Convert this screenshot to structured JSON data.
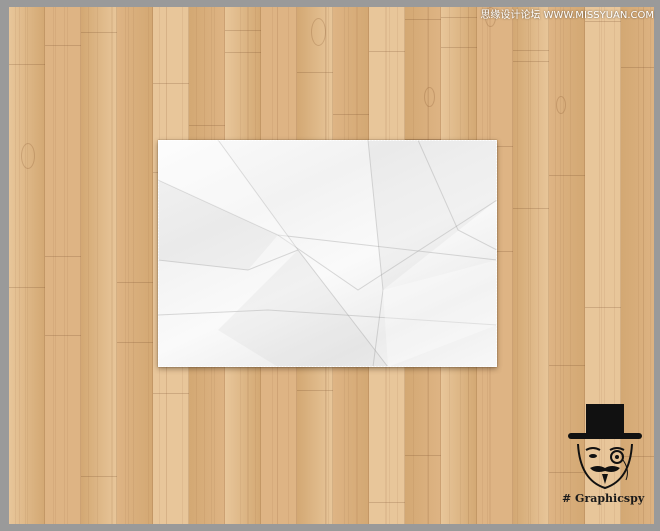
{
  "watermark": {
    "site_text": "思缘设计论坛 WWW.MISSYUAN.COM"
  },
  "logo": {
    "icon": "top-hat-mustache-monocle-face-icon",
    "text": "# Graphicspy"
  },
  "colors": {
    "wood_light": "#e8c69a",
    "wood_mid": "#deb484",
    "wood_dark": "#d3a873",
    "paper": "#f5f5f5",
    "frame": "#9a9a9a"
  }
}
